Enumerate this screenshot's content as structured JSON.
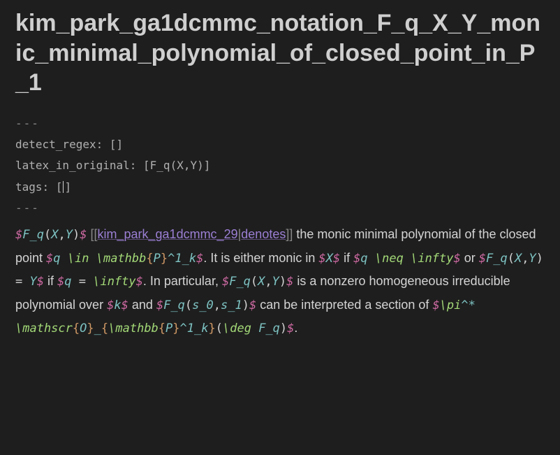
{
  "title": "kim_park_ga1dcmmc_notation_F_q_X_Y_monic_minimal_polynomial_of_closed_point_in_P_1",
  "frontmatter": {
    "open": "---",
    "close": "---",
    "lines": {
      "detect_regex": {
        "key": "detect_regex:",
        "value": "[]"
      },
      "latex_in_original": {
        "key": "latex_in_original:",
        "value": "[F_q(X,Y)]"
      },
      "tags": {
        "key": "tags:",
        "open": "[",
        "close": "]"
      }
    }
  },
  "body": {
    "m_fqxy": "$F_q(X,Y)$",
    "link_raw": "[[kim_park_ga1dcmmc_29|denotes]]",
    "link_target": "kim_park_ga1dcmmc_29",
    "link_text": "denotes",
    "t1": " the monic minimal polynomial of the closed point ",
    "m_qin": "$q \\in \\mathbb{P}^1_k$",
    "t2": ". It is either monic in ",
    "m_x": "$X$",
    "t3": " if ",
    "m_qneq": "$q \\neq \\infty$",
    "t4": " or ",
    "m_fqy": "$F_q(X,Y) = Y$",
    "t5": " if ",
    "m_qeq": "$q = \\infty$",
    "t6": ". In particular, ",
    "m_fqxy2": "$F_q(X,Y)$",
    "t7": " is a nonzero homogeneous irreducible polynomial over ",
    "m_k": "$k$",
    "t8": " and ",
    "m_fqss": "$F_q(s_0,s_1)$",
    "t9": " can be interpreted a section of ",
    "m_pi": "$\\pi^* \\mathscr{O}_{\\mathbb{P}^1_k}(\\deg F_q)$",
    "t10": "."
  }
}
